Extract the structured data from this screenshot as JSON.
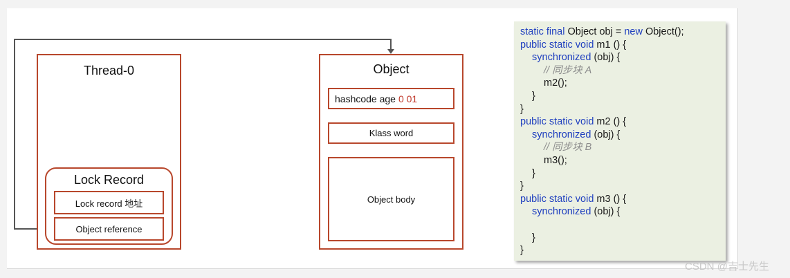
{
  "thread": {
    "title": "Thread-0"
  },
  "lock_record": {
    "title": "Lock Record",
    "slot1": "Lock record 地址",
    "slot2": "Object reference"
  },
  "object": {
    "title": "Object",
    "hashcode_prefix": "hashcode age",
    "hashcode_bits": "0 01",
    "klass": "Klass word",
    "body": "Object body"
  },
  "code": {
    "l1a": "static final",
    "l1b": " Object obj = ",
    "l1c": "new",
    "l1d": " Object();",
    "l2a": "public static void",
    "l2b": " m1 () {",
    "l3a": "synchronized",
    "l3b": " (obj) {",
    "l4": "// 同步块 A",
    "l5": "m2();",
    "l6": "}",
    "l7": "}",
    "l8a": "public static void",
    "l8b": " m2 () {",
    "l9a": "synchronized",
    "l9b": " (obj) {",
    "l10": "// 同步块 B",
    "l11": "m3();",
    "l12": "}",
    "l13": "}",
    "l14a": "public static void",
    "l14b": " m3 () {",
    "l15a": "synchronized",
    "l15b": " (obj) {",
    "l16": "",
    "l17": "}",
    "l18": "}"
  },
  "watermark": "CSDN @吉士先生",
  "colors": {
    "box_border": "#b8472c",
    "bits_red": "#c0392b",
    "keyword_blue": "#1f3fbf",
    "code_bg": "#ebf0e2"
  }
}
